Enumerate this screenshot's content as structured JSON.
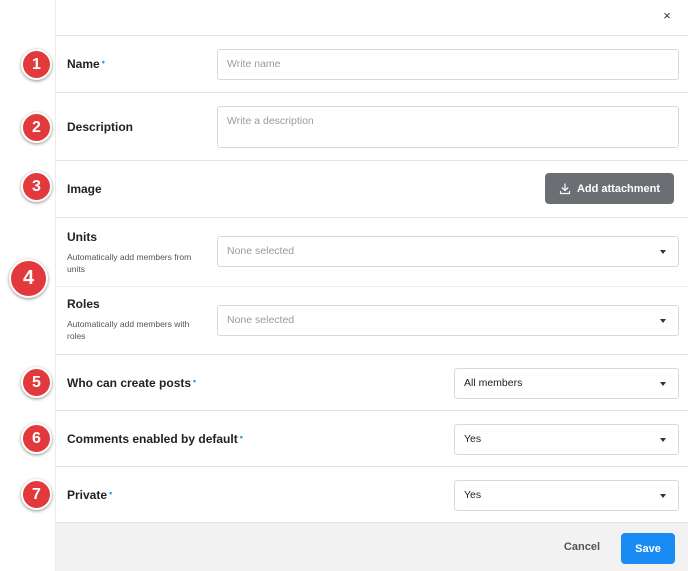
{
  "close_icon": "×",
  "badges": [
    "1",
    "2",
    "3",
    "4",
    "5",
    "6",
    "7"
  ],
  "fields": {
    "name": {
      "label": "Name",
      "required_mark": "•",
      "placeholder": "Write name"
    },
    "description": {
      "label": "Description",
      "placeholder": "Write a description"
    },
    "image": {
      "label": "Image",
      "button_label": "Add attachment"
    },
    "units": {
      "label": "Units",
      "help": "Automatically add members from units",
      "value": "None selected"
    },
    "roles": {
      "label": "Roles",
      "help": "Automatically add members with roles",
      "value": "None selected"
    },
    "who_can_post": {
      "label": "Who can create posts",
      "required_mark": "•",
      "value": "All members"
    },
    "comments_default": {
      "label": "Comments enabled by default",
      "required_mark": "•",
      "value": "Yes"
    },
    "private": {
      "label": "Private",
      "required_mark": "•",
      "value": "Yes"
    }
  },
  "footer": {
    "cancel_label": "Cancel",
    "save_label": "Save"
  },
  "colors": {
    "badge": "#e2393d",
    "save": "#1a8bf2",
    "attach_button": "#6b6f73",
    "required": "#2a9bd6"
  }
}
